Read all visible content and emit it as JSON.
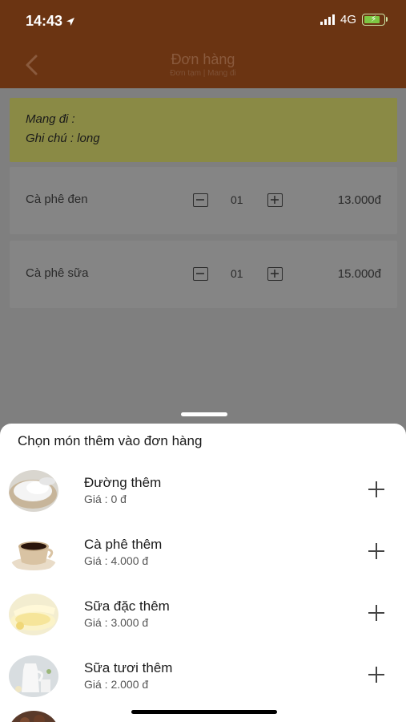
{
  "status_bar": {
    "time": "14:43",
    "network": "4G"
  },
  "header": {
    "title": "Đơn hàng",
    "subtitle": "Đơn tạm | Mang đi"
  },
  "note": {
    "line1": "Mang đi :",
    "line2": "Ghi chú : long"
  },
  "order_items": [
    {
      "name": "Cà phê đen",
      "qty": "01",
      "price": "13.000đ"
    },
    {
      "name": "Cà phê sữa",
      "qty": "01",
      "price": "15.000đ"
    }
  ],
  "sheet": {
    "title": "Chọn món thêm vào đơn hàng",
    "items": [
      {
        "name": "Đường thêm",
        "price": "Giá : 0 đ",
        "thumb": "sugar-image"
      },
      {
        "name": "Cà phê thêm",
        "price": "Giá : 4.000 đ",
        "thumb": "coffee-cup-image"
      },
      {
        "name": "Sữa đặc thêm",
        "price": "Giá : 3.000 đ",
        "thumb": "condensed-milk-image"
      },
      {
        "name": "Sữa tươi thêm",
        "price": "Giá : 2.000 đ",
        "thumb": "fresh-milk-image"
      }
    ]
  },
  "colors": {
    "header_bg": "#6b3412",
    "overlay_bg": "#7f7f7f",
    "note_bg": "#8a8a45",
    "sheet_bg": "#ffffff"
  }
}
